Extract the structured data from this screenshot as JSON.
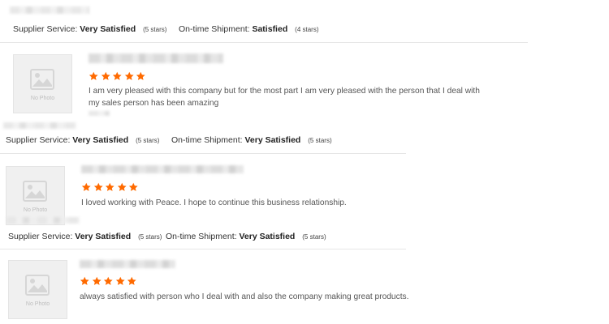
{
  "summaries": [
    {
      "service_label": "Supplier Service:",
      "service_value": "Very Satisfied",
      "service_stars": "(5 stars)",
      "shipment_label": "On-time Shipment:",
      "shipment_value": "Satisfied",
      "shipment_stars": "(4 stars)"
    },
    {
      "service_label": "Supplier Service:",
      "service_value": "Very Satisfied",
      "service_stars": "(5 stars)",
      "shipment_label": "On-time Shipment:",
      "shipment_value": "Very Satisfied",
      "shipment_stars": "(5 stars)"
    },
    {
      "service_label": "Supplier Service:",
      "service_value": "Very Satisfied",
      "service_stars": "(5 stars)",
      "shipment_label": "On-time Shipment:",
      "shipment_value": "Very Satisfied",
      "shipment_stars": "(5 stars)"
    }
  ],
  "reviews": [
    {
      "photo_label": "No Photo",
      "rating": 5,
      "text_line1": "I am very pleased with this company but for the most part I am very pleased with the person that I deal with",
      "text_line2": "my sales person has been amazing"
    },
    {
      "photo_label": "No Photo",
      "rating": 5,
      "text_line1": "I loved working with Peace.  I hope to continue this business relationship."
    },
    {
      "photo_label": "No Photo",
      "rating": 5,
      "text_line1": "always satisfied with person who I deal with and also the company making great products."
    }
  ],
  "colors": {
    "star": "#ff6a00",
    "divider": "#e6e6e6",
    "photo_bg": "#f0f0f0"
  }
}
